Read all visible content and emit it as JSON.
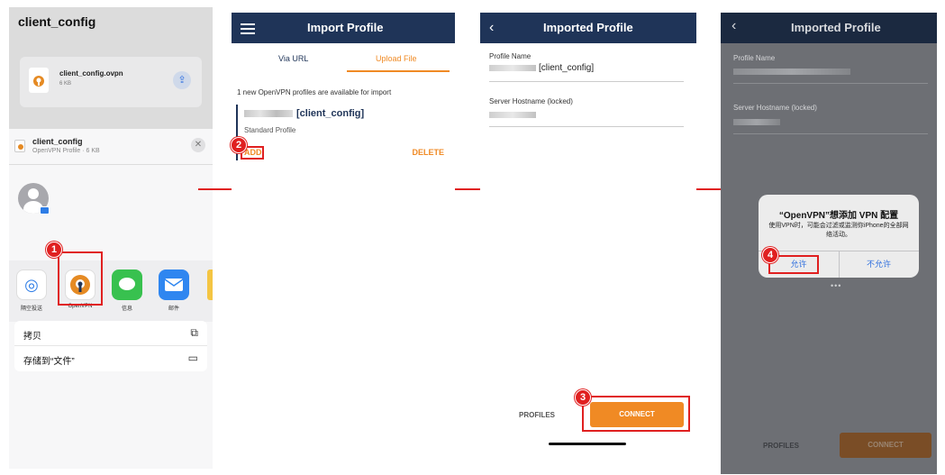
{
  "panel1": {
    "title": "client_config",
    "file_name": "client_config.ovpn",
    "file_size": "6 KB",
    "share_title": "client_config",
    "share_subtitle": "OpenVPN Profile · 6 KB",
    "apps": [
      {
        "label": "隔空投送",
        "icon": "airdrop-icon",
        "color": "#2e7de6"
      },
      {
        "label": "OpenVPN",
        "icon": "openvpn-icon",
        "color": "#e58a23"
      },
      {
        "label": "信息",
        "icon": "messages-icon",
        "color": "#38c14f"
      },
      {
        "label": "邮件",
        "icon": "mail-icon",
        "color": "#2f86f0"
      }
    ],
    "actions": [
      {
        "label": "拷贝",
        "icon": "copy-icon"
      },
      {
        "label": "存储到“文件”",
        "icon": "folder-icon"
      }
    ]
  },
  "panel2": {
    "title": "Import Profile",
    "tab_url": "Via URL",
    "tab_upload": "Upload File",
    "info": "1 new OpenVPN profiles are available for import",
    "profile_name": "[client_config]",
    "profile_type": "Standard Profile",
    "add": "ADD",
    "delete": "DELETE"
  },
  "panel3": {
    "title": "Imported Profile",
    "profile_name_label": "Profile Name",
    "profile_name_value": "[client_config]",
    "hostname_label": "Server Hostname (locked)",
    "profiles": "PROFILES",
    "connect": "CONNECT"
  },
  "panel4": {
    "title": "Imported Profile",
    "profile_name_label": "Profile Name",
    "hostname_label": "Server Hostname (locked)",
    "dialog_title": "“OpenVPN”想添加 VPN 配置",
    "dialog_message": "使用VPN时，可能会过滤或监测你iPhone的全部网络活动。",
    "allow": "允许",
    "deny": "不允许",
    "profiles": "PROFILES",
    "connect": "CONNECT"
  },
  "steps": [
    "1",
    "2",
    "3",
    "4"
  ],
  "colors": {
    "navy": "#1f3458",
    "orange": "#f08a24",
    "red": "#e02020"
  }
}
